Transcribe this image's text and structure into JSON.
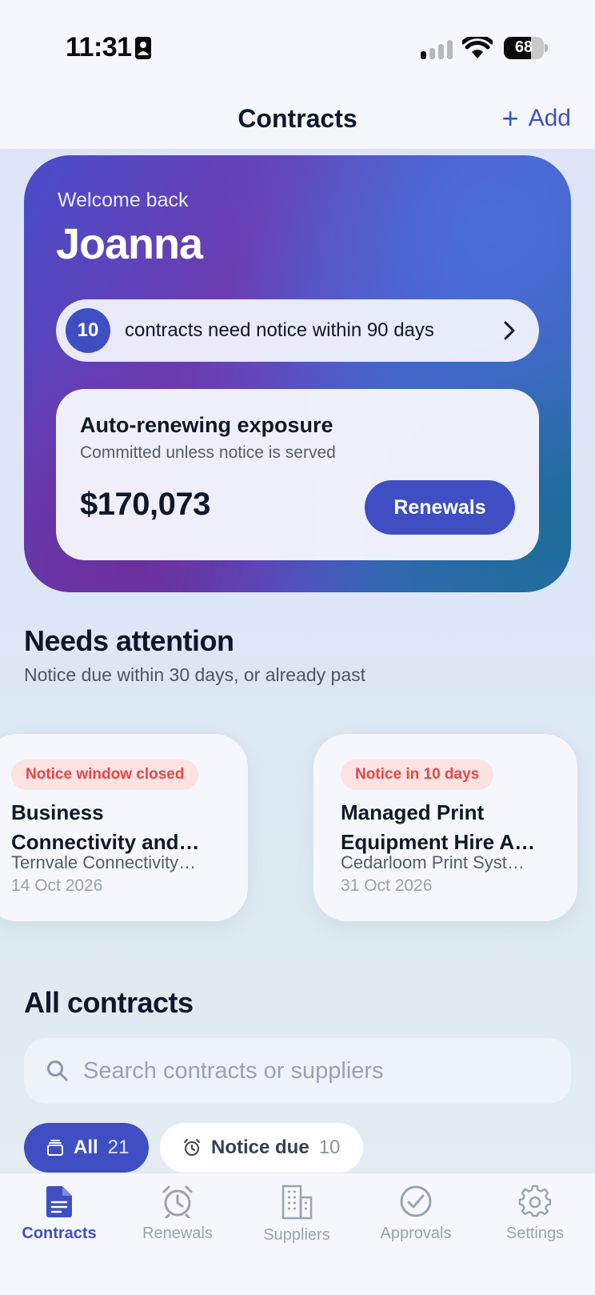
{
  "status_bar": {
    "time": "11:31",
    "battery": "68",
    "battery_level": 0.68
  },
  "nav": {
    "title": "Contracts",
    "add_label": "Add"
  },
  "hero": {
    "welcome": "Welcome back",
    "name": "Joanna",
    "notice_count": "10",
    "notice_text": "contracts need notice within 90 days"
  },
  "exposure": {
    "title": "Auto-renewing exposure",
    "subtitle": "Committed unless notice is served",
    "amount": "$170,073",
    "button_label": "Renewals"
  },
  "needs_attention": {
    "title": "Needs attention",
    "subtitle": "Notice due within 30 days, or already past",
    "cards": [
      {
        "badge": "Notice window closed",
        "title": "Business Connectivity and…",
        "supplier": "Ternvale Connectivity…",
        "date": "14 Oct 2026"
      },
      {
        "badge": "Notice in 10 days",
        "title": "Managed Print Equipment Hire A…",
        "supplier": "Cedarloom Print Syst…",
        "date": "31 Oct 2026"
      }
    ]
  },
  "all_contracts": {
    "title": "All contracts",
    "search_placeholder": "Search contracts or suppliers",
    "chips": [
      {
        "label": "All",
        "count": "21",
        "icon": "stack-icon"
      },
      {
        "label": "Notice due",
        "count": "10",
        "icon": "alarm-clock-icon"
      }
    ]
  },
  "tabs": [
    {
      "label": "Contracts",
      "icon": "document-icon",
      "active": true
    },
    {
      "label": "Renewals",
      "icon": "alarm-clock-icon",
      "active": false
    },
    {
      "label": "Suppliers",
      "icon": "building-icon",
      "active": false
    },
    {
      "label": "Approvals",
      "icon": "check-circle-icon",
      "active": false
    },
    {
      "label": "Settings",
      "icon": "gear-icon",
      "active": false
    }
  ],
  "colors": {
    "accent": "#3f4fc3",
    "danger": "#e24848",
    "danger_bg": "#fde2e2"
  }
}
